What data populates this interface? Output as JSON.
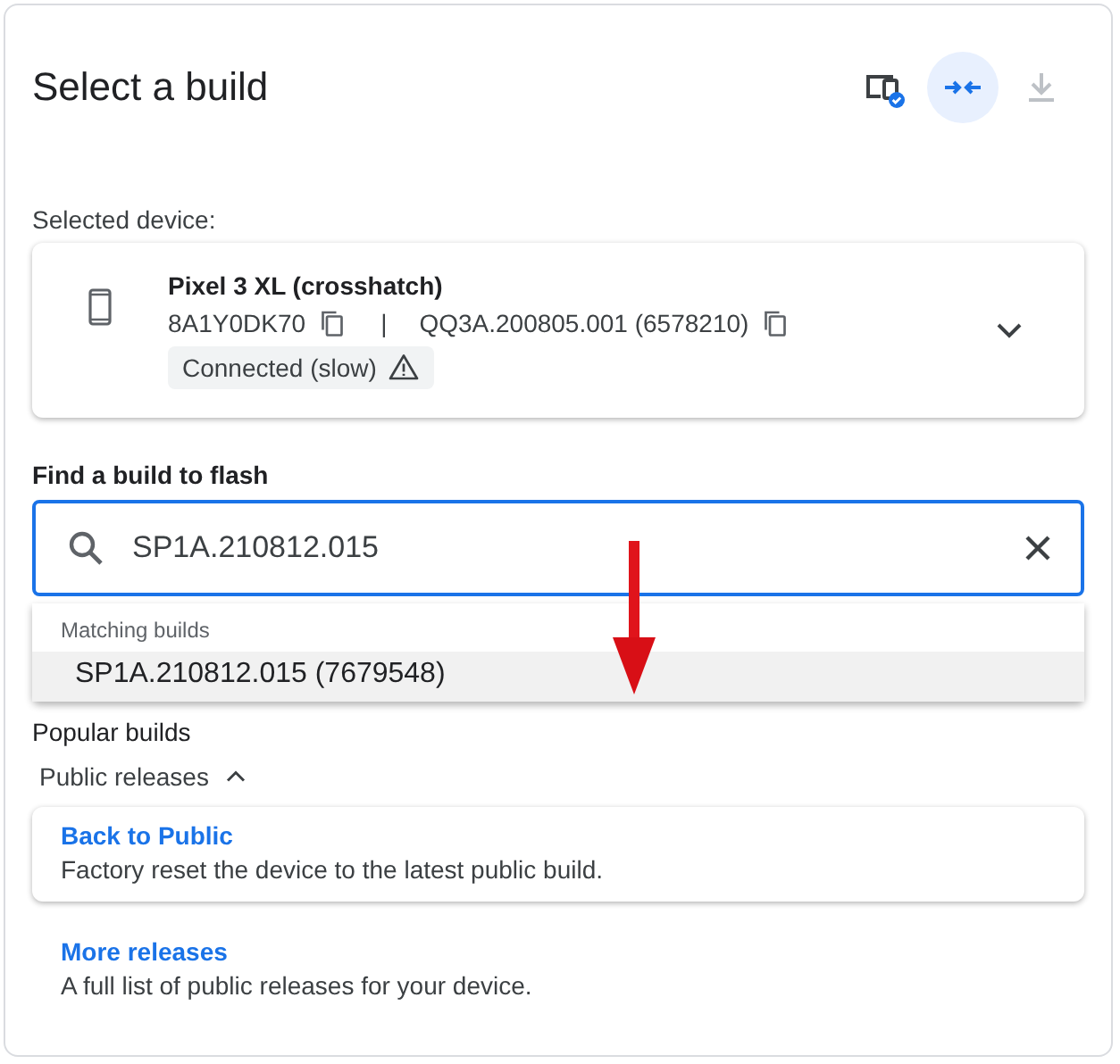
{
  "header": {
    "title": "Select a build",
    "actions": [
      {
        "kind": "device-check",
        "active": false,
        "disabled": false
      },
      {
        "kind": "compact",
        "active": true,
        "disabled": false
      },
      {
        "kind": "download",
        "active": false,
        "disabled": true
      }
    ]
  },
  "device": {
    "label": "Selected device:",
    "name": "Pixel 3 XL (crosshatch)",
    "serial": "8A1Y0DK70",
    "separator": "|",
    "build": "QQ3A.200805.001 (6578210)",
    "status": "Connected (slow)",
    "warning": true,
    "expanded": false
  },
  "search": {
    "label": "Find a build to flash",
    "value": "SP1A.210812.015",
    "suggestions": {
      "heading": "Matching builds",
      "options": [
        {
          "label": "SP1A.210812.015 (7679548)",
          "selected": true
        }
      ]
    }
  },
  "popular": {
    "heading": "Popular builds",
    "toggle": "Public releases",
    "expanded": true,
    "releases": [
      {
        "kind": "card",
        "title": "Back to Public",
        "description": "Factory reset the device to the latest public build."
      },
      {
        "kind": "plain",
        "title": "More releases",
        "description": "A full list of public releases for your device."
      }
    ]
  }
}
